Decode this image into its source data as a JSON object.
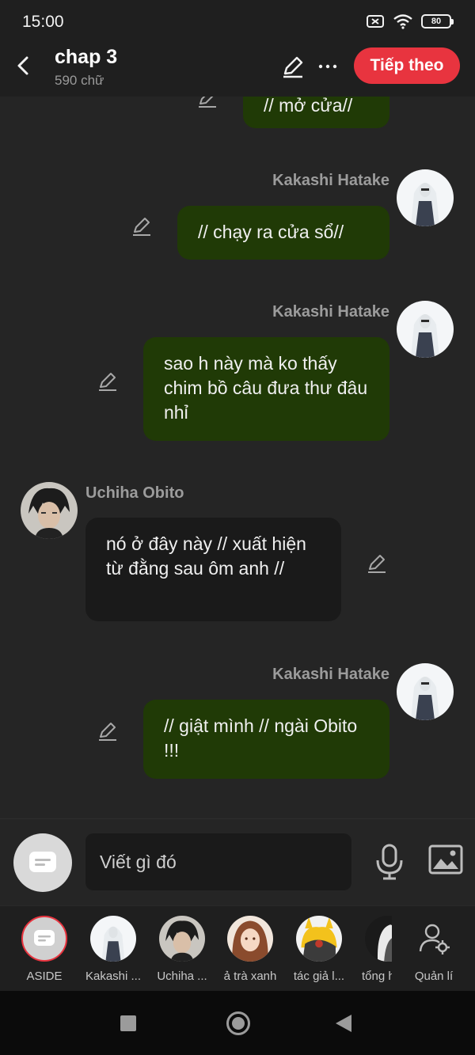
{
  "status_bar": {
    "time": "15:00",
    "battery": "80"
  },
  "header": {
    "title": "chap 3",
    "subtitle": "590 chữ",
    "next_label": "Tiếp theo"
  },
  "messages": [
    {
      "side": "me",
      "sender": "",
      "text": "// mở cửa//"
    },
    {
      "side": "me",
      "sender": "Kakashi Hatake",
      "text": "// chạy ra cửa sổ//"
    },
    {
      "side": "me",
      "sender": "Kakashi Hatake",
      "text": "sao h này mà ko thấy chim bồ câu đưa thư đâu nhỉ"
    },
    {
      "side": "other",
      "sender": "Uchiha Obito",
      "text": "nó ở đây này // xuất hiện từ đằng sau ôm anh //"
    },
    {
      "side": "me",
      "sender": "Kakashi Hatake",
      "text": "// giật mình // ngài Obito !!!"
    }
  ],
  "input": {
    "placeholder": "Viết gì đó"
  },
  "characters": [
    {
      "label": "ASIDE"
    },
    {
      "label": "Kakashi ..."
    },
    {
      "label": "Uchiha ..."
    },
    {
      "label": "ả trà xanh"
    },
    {
      "label": "tác giả l..."
    },
    {
      "label": "tổng h"
    },
    {
      "label": "Quản lí"
    }
  ]
}
